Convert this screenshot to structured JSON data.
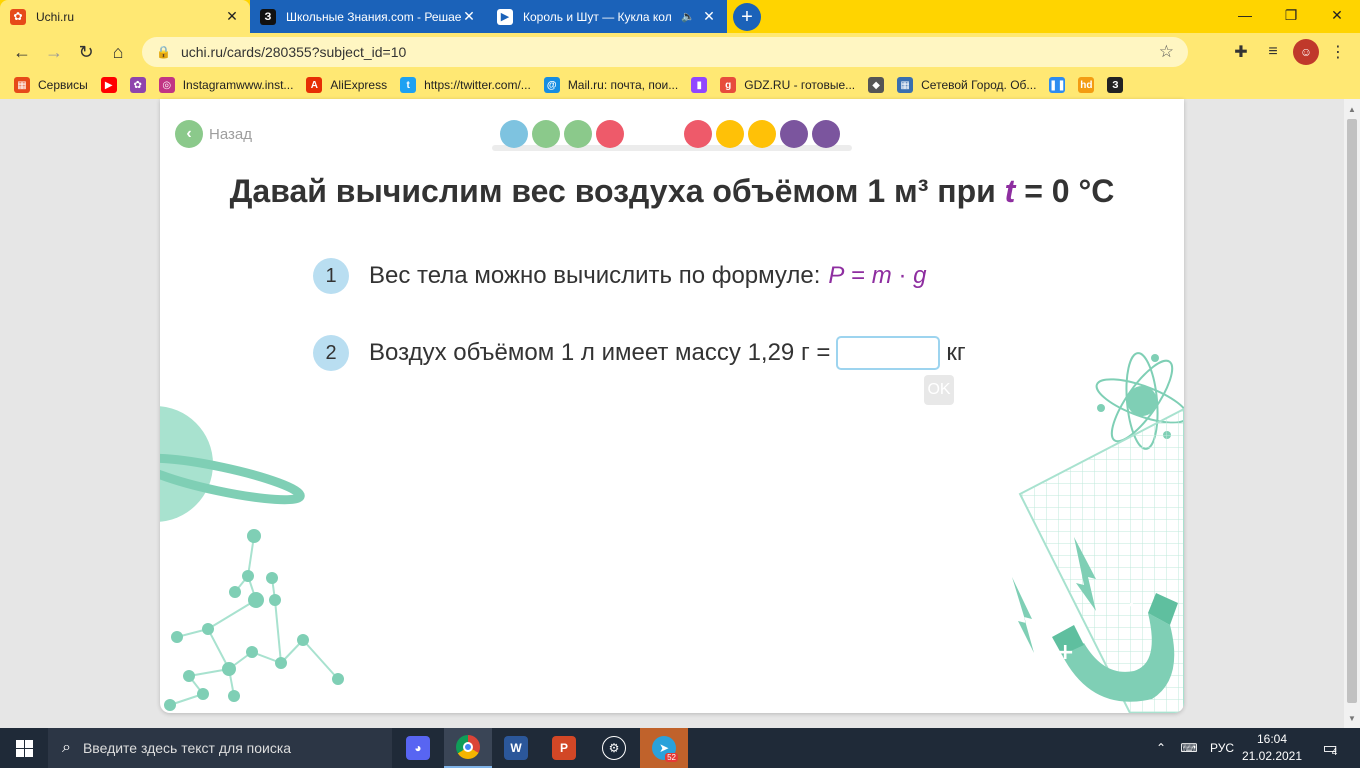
{
  "browser": {
    "tabs": [
      {
        "title": "Uchi.ru",
        "close": "✕"
      },
      {
        "title": "Школьные Знания.com - Решае",
        "close": "✕"
      },
      {
        "title": "Король и Шут — Кукла кол",
        "close": "✕"
      }
    ],
    "new_tab": "+",
    "window_buttons": {
      "minimize": "—",
      "restore": "❐",
      "close": "✕"
    },
    "url": "uchi.ru/cards/280355?subject_id=10",
    "bookmarks": [
      {
        "label": "Сервисы",
        "color": "#e64a19"
      },
      {
        "label": "",
        "color": "#ff0000"
      },
      {
        "label": "",
        "color": "#8e44ad"
      },
      {
        "label": "Instagramwww.inst...",
        "color": "#c13584"
      },
      {
        "label": "AliExpress",
        "color": "#e62e04"
      },
      {
        "label": "https://twitter.com/...",
        "color": "#1da1f2"
      },
      {
        "label": "Mail.ru: почта, пои...",
        "color": "#168de2"
      },
      {
        "label": "",
        "color": "#9146ff"
      },
      {
        "label": "GDZ.RU - готовые...",
        "color": "#e74c3c"
      },
      {
        "label": "",
        "color": "#555555"
      },
      {
        "label": "Сетевой Город. Об...",
        "color": "#3a6fb0"
      },
      {
        "label": "",
        "color": "#2d8cf0"
      },
      {
        "label": "",
        "color": "#f39c12"
      },
      {
        "label": "",
        "color": "#222222"
      }
    ]
  },
  "page": {
    "back_label": "Назад",
    "progress_dots": [
      "#7ec3e0",
      "#8bc98b",
      "#8bc98b",
      "#ee5a6a",
      "#ee5a6a",
      "#ffc107",
      "#ffc107",
      "#7b559e",
      "#7b559e"
    ],
    "title_prefix": "Давай вычислим вес воздуха объёмом 1 м³ при ",
    "title_var": "t",
    "title_suffix": " = 0 °C",
    "step1": {
      "num": "1",
      "text": "Вес тела можно вычислить по формуле:",
      "f_p": "P",
      "f_eq": " = ",
      "f_m": "m",
      "f_dot": " · ",
      "f_g": "g"
    },
    "step2": {
      "num": "2",
      "text": "Воздух объёмом 1 л имеет массу 1,29 г =",
      "answer_value": "",
      "unit": "кг"
    },
    "ok_label": "OK"
  },
  "taskbar": {
    "search_placeholder": "Введите здесь текст для поиска",
    "language": "РУС",
    "time": "16:04",
    "date": "21.02.2021",
    "notifications": "4",
    "telegram_badge": "52"
  },
  "colors": {
    "accent_yellow": "#ffd400",
    "tab_blue": "#1b62b9",
    "purple": "#8e2ea0",
    "teal_deco": "#7fcfb5"
  }
}
